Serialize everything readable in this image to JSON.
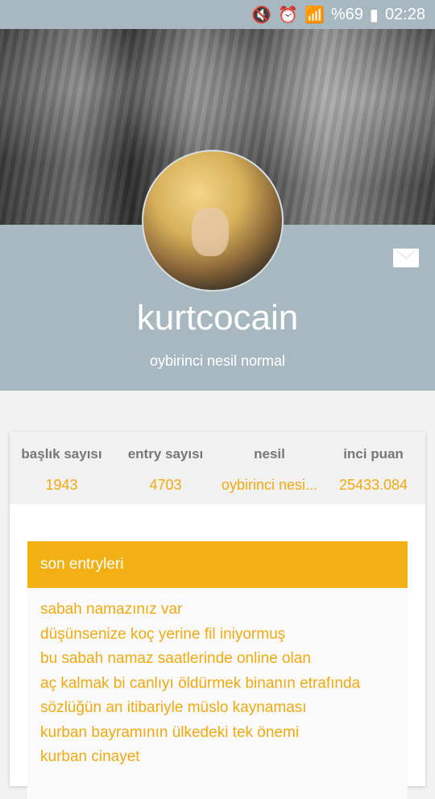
{
  "status_bar": {
    "battery": "%69",
    "time": "02:28",
    "icons": [
      "mute-icon",
      "alarm-icon",
      "wifi-icon",
      "signal-icon",
      "battery-icon"
    ]
  },
  "profile": {
    "username": "kurtcocain",
    "subtitle": "oybirinci nesil normal"
  },
  "stats": [
    {
      "label": "başlık sayısı",
      "value": "1943"
    },
    {
      "label": "entry sayısı",
      "value": "4703"
    },
    {
      "label": "nesil",
      "value": "oybirinci nesi..."
    },
    {
      "label": "inci puan",
      "value": "25433.084"
    }
  ],
  "recent": {
    "title": "son entryleri",
    "entries": [
      "sabah namazınız var",
      "düşünsenize koç yerine fil iniyormuş",
      "bu sabah namaz saatlerinde online olan",
      "aç kalmak bi canlıyı öldürmek binanın etrafında",
      "sözlüğün an itibariyle müslo kaynaması",
      "kurban bayramının ülkedeki tek önemi",
      "kurban cinayet"
    ]
  },
  "colors": {
    "band": "#a8b8c0",
    "accent": "#f2b014",
    "accent_text": "#f2a90d"
  }
}
